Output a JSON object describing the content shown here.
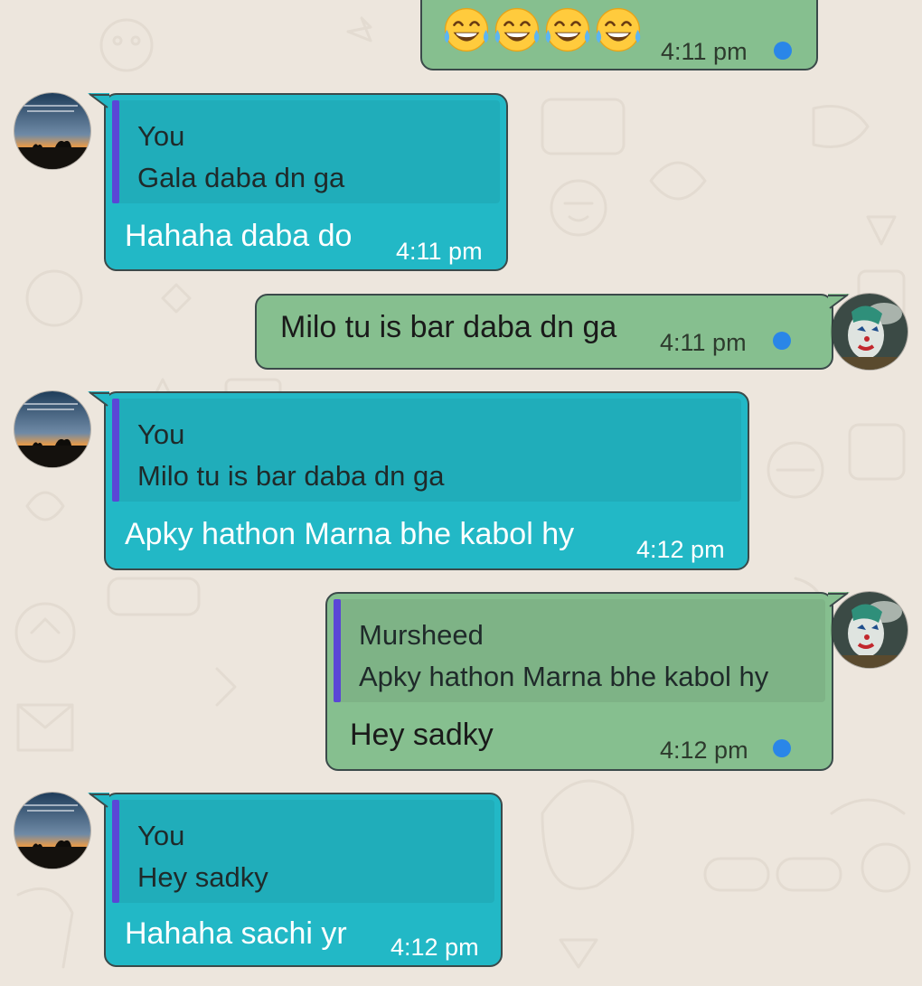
{
  "colors": {
    "incoming_bubble": "#22b8c6",
    "outgoing_bubble": "#86bf8f",
    "quote_bar": "#5a46d6",
    "status_dot": "#2a86e8",
    "background": "#ede6dd"
  },
  "messages": [
    {
      "direction": "outgoing",
      "content": "😂😂😂😂",
      "time": "4:11 pm",
      "status_icon": "sent-dot-icon"
    },
    {
      "direction": "incoming",
      "quote_author": "You",
      "quote_text": "Gala daba dn ga",
      "text": "Hahaha daba do",
      "time": "4:11 pm"
    },
    {
      "direction": "outgoing",
      "text": "Milo tu is bar daba dn ga",
      "time": "4:11 pm",
      "status_icon": "sent-dot-icon"
    },
    {
      "direction": "incoming",
      "quote_author": "You",
      "quote_text": "Milo tu is bar daba dn ga",
      "text": "Apky hathon Marna bhe kabol hy",
      "time": "4:12 pm"
    },
    {
      "direction": "outgoing",
      "quote_author": "Mursheed",
      "quote_text": "Apky hathon Marna bhe kabol hy",
      "text": "Hey sadky",
      "time": "4:12 pm",
      "status_icon": "sent-dot-icon"
    },
    {
      "direction": "incoming",
      "quote_author": "You",
      "quote_text": "Hey sadky",
      "text": "Hahaha sachi yr",
      "time": "4:12 pm"
    }
  ]
}
